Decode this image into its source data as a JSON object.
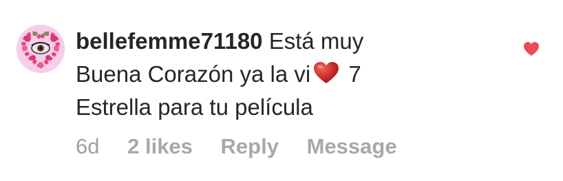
{
  "comment": {
    "username": "bellefemme71180",
    "text_part1": "Está muy Buena Corazón ya la vi",
    "emoji": "red-heart",
    "text_part2": "7 Estrella para tu película",
    "time": "6d",
    "likes": "2 likes",
    "reply_label": "Reply",
    "message_label": "Message",
    "liked": true
  },
  "colors": {
    "text": "#262626",
    "meta": "#a8a8a8",
    "like_heart": "#ed4956",
    "emoji_heart": "#c62828"
  }
}
